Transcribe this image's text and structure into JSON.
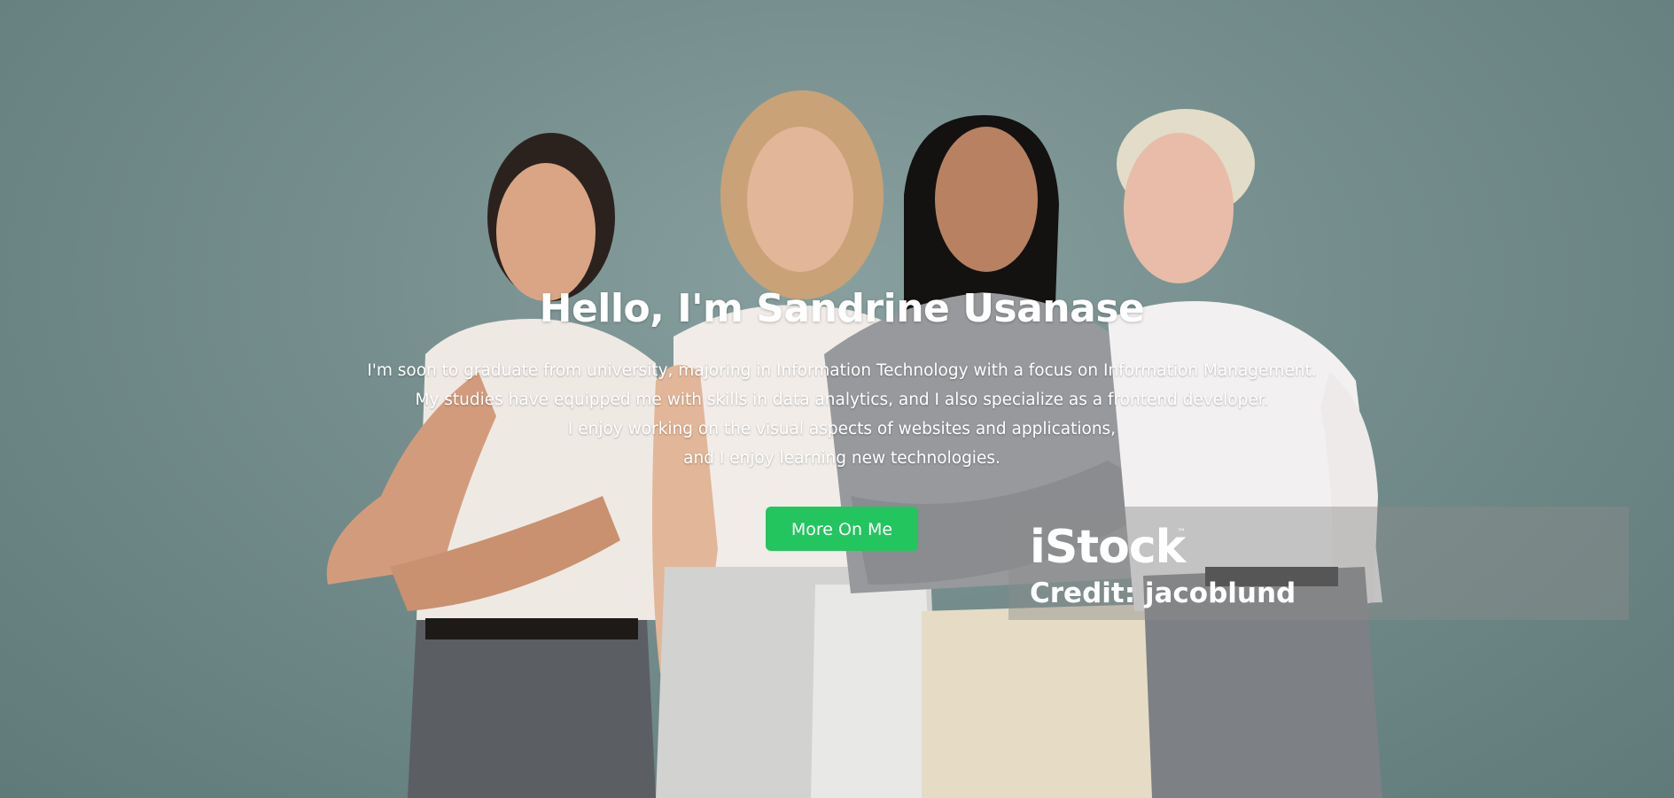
{
  "hero": {
    "title": "Hello, I'm Sandrine Usanase",
    "intro_lines": [
      "I'm soon to graduate from university, majoring in Information Technology with a focus on Information Management.",
      "My studies have equipped me with skills in data analytics, and I also specialize as a frontend developer.",
      "I enjoy working on the visual aspects of websites and applications,",
      "and I enjoy learning new technologies."
    ],
    "cta_label": "More On Me",
    "cta_color": "#22c55e",
    "background_color": "#6e8a89"
  },
  "watermark": {
    "logo": "iStock",
    "trademark": "™",
    "credit": "Credit: jacoblund"
  }
}
